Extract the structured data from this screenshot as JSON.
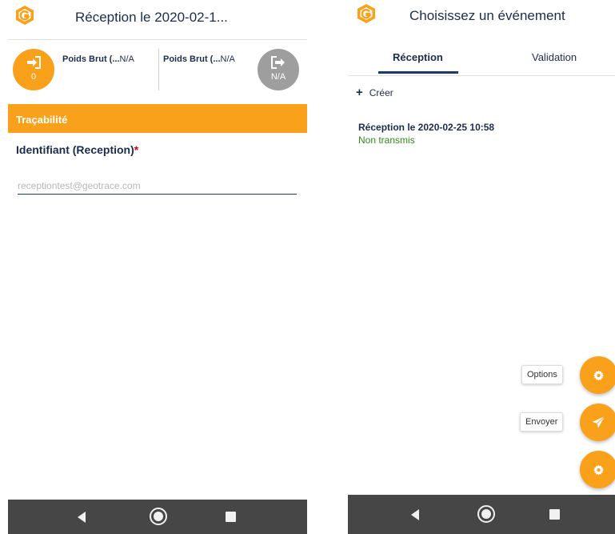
{
  "left": {
    "header": {
      "title": "Réception le 2020-02-1..."
    },
    "counters": {
      "in": {
        "count": "0",
        "label": "Poids Brut (...",
        "value": "N/A"
      },
      "out": {
        "count": "N/A",
        "label": "Poids Brut (...",
        "value": "N/A"
      }
    },
    "section": {
      "title": "Traçabilité"
    },
    "field": {
      "label": "Identifiant (Reception)",
      "required_mark": "*",
      "value": "receptiontest@geotrace.com"
    }
  },
  "right": {
    "header": {
      "title": "Choisissez un événement"
    },
    "tabs": [
      {
        "label": "Réception",
        "active": true
      },
      {
        "label": "Validation",
        "active": false
      }
    ],
    "create": {
      "label": "Créer"
    },
    "event": {
      "title": "Réception le 2020-02-25 10:58",
      "status": "Non transmis"
    },
    "fab": {
      "options_label": "Options",
      "send_label": "Envoyer"
    }
  },
  "icons": {
    "logo": "geotrace-logo-icon",
    "entry": "sign-in-icon",
    "exit": "sign-out-icon",
    "gear": "gear-icon",
    "send": "paper-plane-icon",
    "nav_back": "back-triangle-icon",
    "nav_home": "home-circle-icon",
    "nav_recent": "recent-square-icon"
  },
  "colors": {
    "accent": "#f9a11b",
    "navy": "#1b2d4f",
    "grey_button": "#9e9e9e",
    "status_green": "#2e8b1e",
    "nav_bar": "#464646"
  }
}
